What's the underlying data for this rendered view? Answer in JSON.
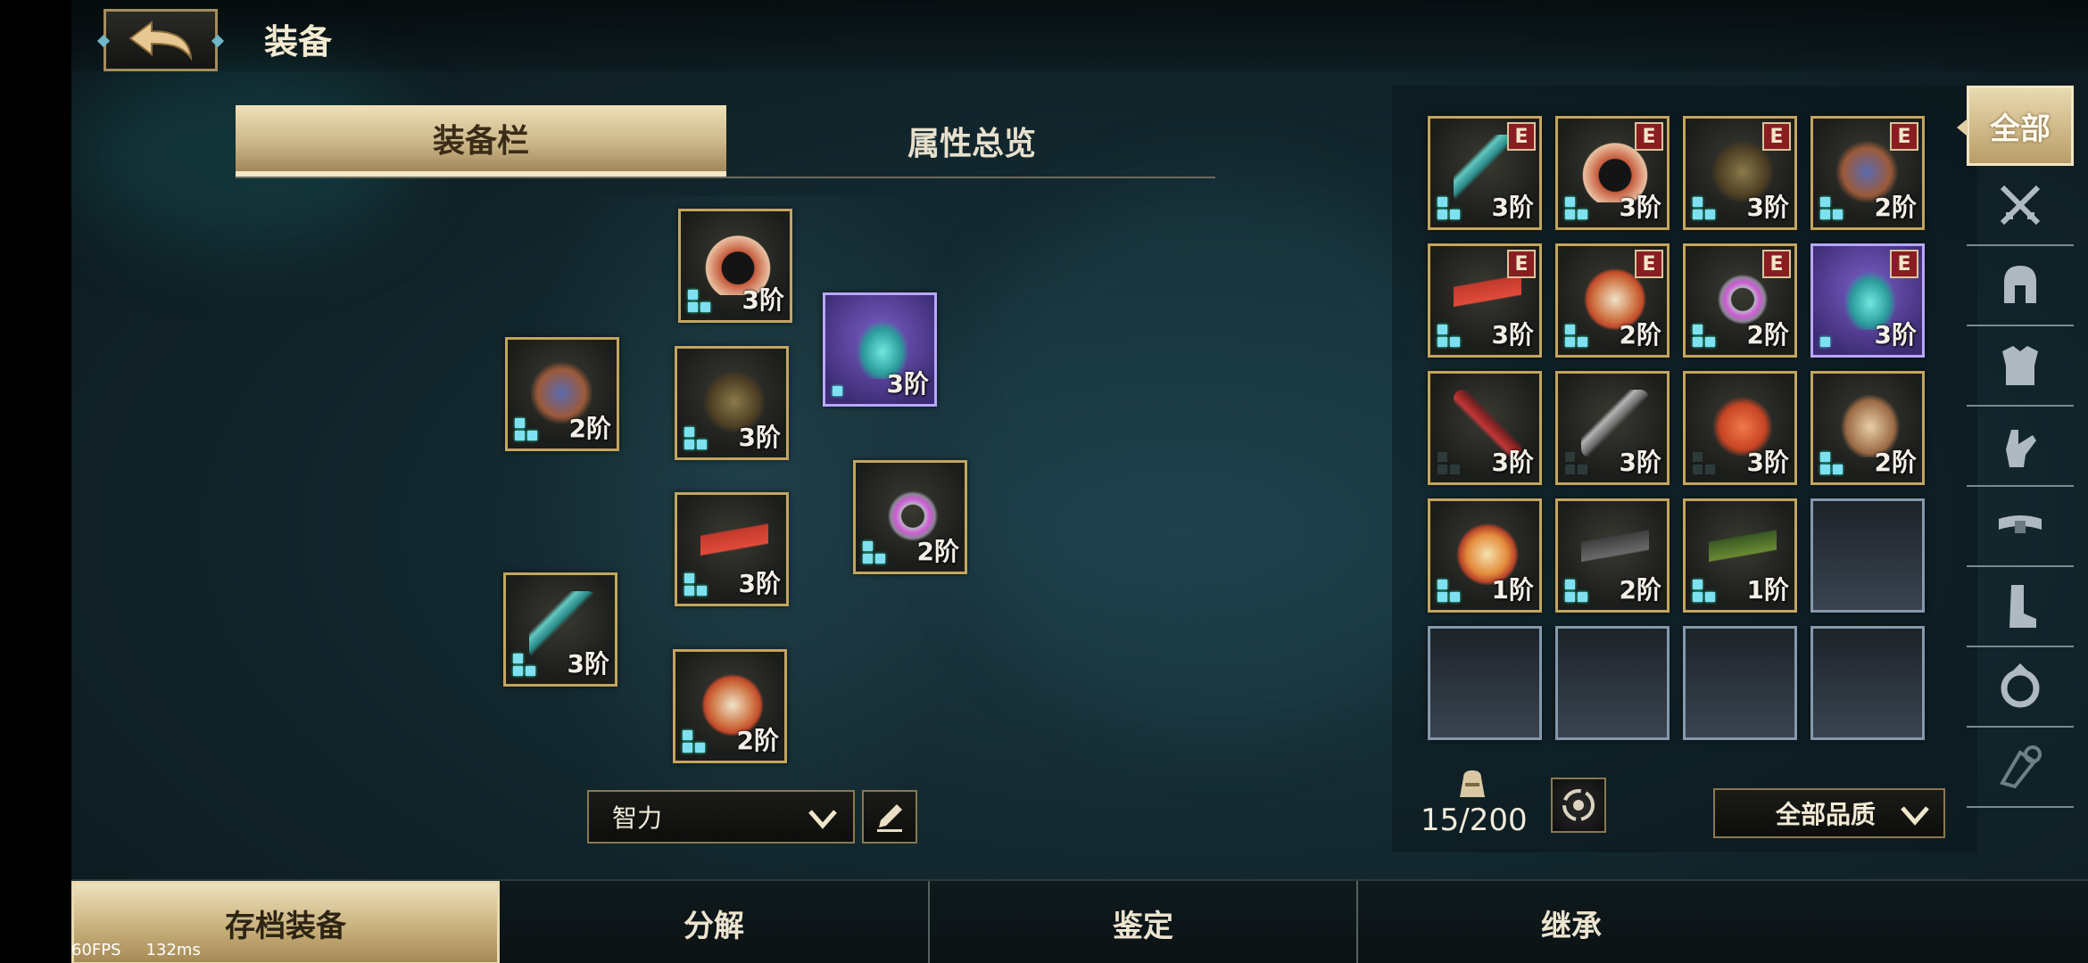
{
  "header": {
    "title": "装备"
  },
  "tabs": [
    {
      "label": "装备栏"
    },
    {
      "label": "属性总览"
    }
  ],
  "equipped": {
    "hood": {
      "tier": "3阶"
    },
    "gem": {
      "tier": "3阶"
    },
    "glove": {
      "tier": "2阶"
    },
    "armor": {
      "tier": "3阶"
    },
    "ring": {
      "tier": "2阶"
    },
    "belt": {
      "tier": "3阶"
    },
    "bow": {
      "tier": "3阶"
    },
    "boot": {
      "tier": "2阶"
    }
  },
  "stat_select": {
    "value": "智力"
  },
  "inventory": [
    {
      "item": "bow-icon",
      "tier": "3阶",
      "badge": "E"
    },
    {
      "item": "hood-icon",
      "tier": "3阶",
      "badge": "E"
    },
    {
      "item": "armor-icon",
      "tier": "3阶",
      "badge": "E"
    },
    {
      "item": "glove-icon",
      "tier": "2阶",
      "badge": "E"
    },
    {
      "item": "belt-icon",
      "tier": "3阶",
      "badge": "E"
    },
    {
      "item": "boot-icon",
      "tier": "2阶",
      "badge": "E"
    },
    {
      "item": "ring-icon",
      "tier": "2阶",
      "badge": "E"
    },
    {
      "item": "gem-icon",
      "tier": "3阶",
      "badge": "E"
    },
    {
      "item": "spear-icon",
      "tier": "3阶"
    },
    {
      "item": "swords-icon",
      "tier": "3阶"
    },
    {
      "item": "helmet-icon",
      "tier": "3阶"
    },
    {
      "item": "cape-icon",
      "tier": "2阶"
    },
    {
      "item": "gauntlet-icon",
      "tier": "1阶"
    },
    {
      "item": "belt-icon",
      "tier": "2阶"
    },
    {
      "item": "belt-icon",
      "tier": "1阶"
    }
  ],
  "bag": {
    "count": "15/200"
  },
  "quality_filter": {
    "value": "全部品质"
  },
  "categories": [
    {
      "label": "全部"
    },
    {
      "icon": "crossed-swords-icon"
    },
    {
      "icon": "helmet-icon"
    },
    {
      "icon": "armor-icon"
    },
    {
      "icon": "glove-icon"
    },
    {
      "icon": "belt-icon"
    },
    {
      "icon": "boot-icon"
    },
    {
      "icon": "ring-icon"
    },
    {
      "icon": "gem-icon"
    }
  ],
  "bottom_tabs": [
    {
      "label": "存档装备"
    },
    {
      "label": "分解"
    },
    {
      "label": "鉴定"
    },
    {
      "label": "继承"
    }
  ],
  "debug": {
    "fps": "60FPS",
    "latency": "132ms"
  }
}
